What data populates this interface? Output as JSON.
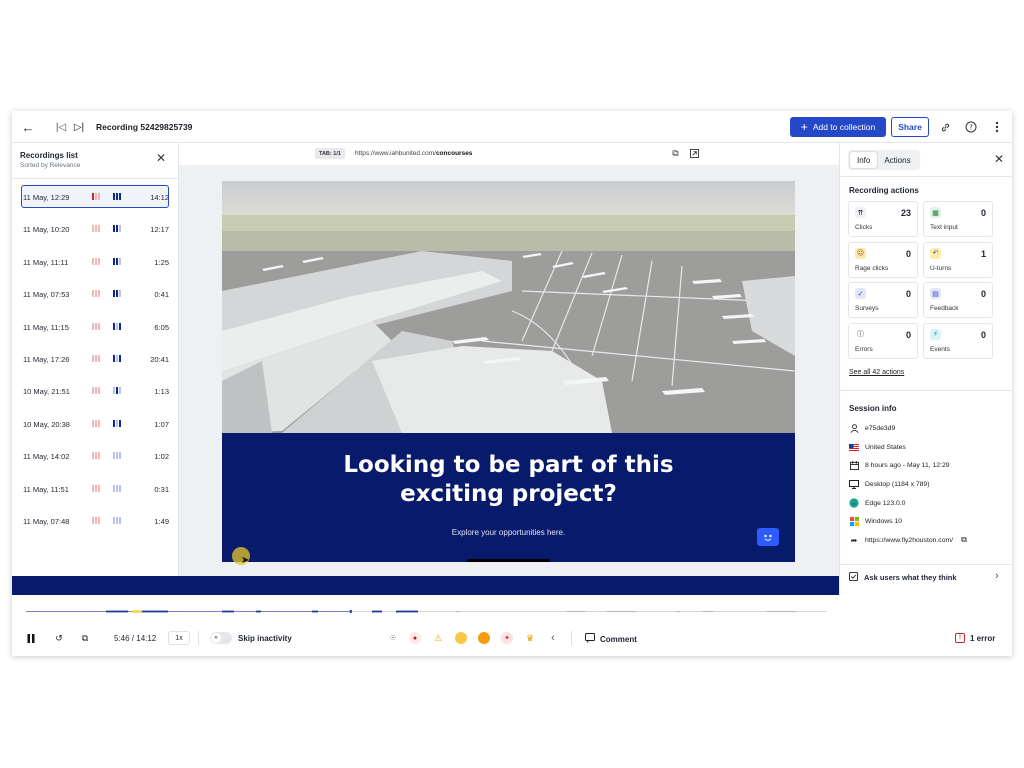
{
  "topbar": {
    "title": "Recording 52429825739",
    "add_label": "Add to collection",
    "share_label": "Share"
  },
  "recordings": {
    "title": "Recordings list",
    "subtitle": "Sorted by Relevance",
    "items": [
      {
        "date": "11 May, 12:29",
        "duration": "14:12",
        "selected": true
      },
      {
        "date": "11 May, 10:20",
        "duration": "12:17"
      },
      {
        "date": "11 May, 11:11",
        "duration": "1:25"
      },
      {
        "date": "11 May, 07:53",
        "duration": "0:41"
      },
      {
        "date": "11 May, 11:15",
        "duration": "6:05"
      },
      {
        "date": "11 May, 17:26",
        "duration": "20:41"
      },
      {
        "date": "10 May, 21:51",
        "duration": "1:13"
      },
      {
        "date": "10 May, 20:38",
        "duration": "1:07"
      },
      {
        "date": "11 May, 14:02",
        "duration": "1:02"
      },
      {
        "date": "11 May, 11:51",
        "duration": "0:31"
      },
      {
        "date": "11 May, 07:48",
        "duration": "1:49"
      }
    ]
  },
  "player": {
    "tab": "TAB: 1/1",
    "url_prefix": "https://www.iahbunited.com/",
    "url_path": "concourses",
    "hero_title_1": "Looking to be part of this",
    "hero_title_2": "exciting project?",
    "hero_sub": "Explore your opportunities here."
  },
  "timeline": {
    "time": "5:46 / 14:12",
    "speed": "1x",
    "skip_label": "Skip inactivity",
    "comment_label": "Comment",
    "error_label": "1 error",
    "progress_fraction": 0.406
  },
  "info": {
    "tab_info": "Info",
    "tab_actions": "Actions",
    "actions_title": "Recording actions",
    "actions": [
      {
        "label": "Clicks",
        "count": "23",
        "icon": "click-icon"
      },
      {
        "label": "Text input",
        "count": "0",
        "icon": "text-input-icon"
      },
      {
        "label": "Rage clicks",
        "count": "0",
        "icon": "rage-icon"
      },
      {
        "label": "U-turns",
        "count": "1",
        "icon": "u-turn-icon"
      },
      {
        "label": "Surveys",
        "count": "0",
        "icon": "survey-icon"
      },
      {
        "label": "Feedback",
        "count": "0",
        "icon": "feedback-icon"
      },
      {
        "label": "Errors",
        "count": "0",
        "icon": "error-icon"
      },
      {
        "label": "Events",
        "count": "0",
        "icon": "events-icon"
      }
    ],
    "see_all": "See all 42 actions",
    "session_title": "Session info",
    "session": {
      "user": "e75de3d9",
      "country": "United States",
      "time": "8 hours ago - May 11, 12:29",
      "device": "Desktop (1184 x 789)",
      "browser": "Edge 123.0.0",
      "os": "Windows 10",
      "referrer": "https://www.fly2houston.com/"
    },
    "ask_label": "Ask users what they think"
  },
  "colors": {
    "accent": "#2548c9",
    "navy": "#081a6b"
  }
}
